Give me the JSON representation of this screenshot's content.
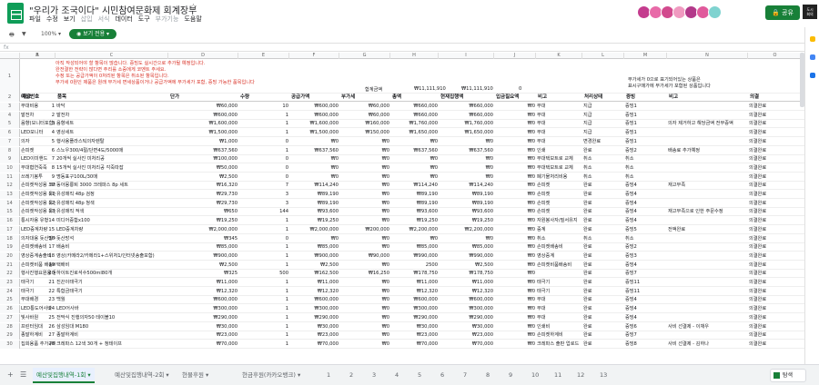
{
  "header": {
    "title": "\"우리가 조국이다\" 시민참여문화제 회계장부",
    "star_icon": "star-icon",
    "menu": [
      "파일",
      "수정",
      "보기",
      "삽입",
      "서식",
      "데이터",
      "도구",
      "부가기능",
      "도움말"
    ],
    "menu_disabled": [
      false,
      false,
      false,
      true,
      true,
      false,
      false,
      true,
      false
    ],
    "share_label": "공유",
    "account_text": "도시\n회의"
  },
  "toolbar": {
    "zoom": "100%",
    "view_only_label": "보기 전용",
    "cell_ref": "fx"
  },
  "columns": [
    "A",
    "B",
    "C",
    "D",
    "E",
    "F",
    "G",
    "H",
    "I",
    "J",
    "K",
    "L",
    "M",
    "N",
    "O"
  ],
  "instructions": {
    "lines": [
      "아직 작성되어야 할 항목이 많습니다. 증빙도 실시간으로 추가될 예정입니다.",
      "완전결한 전략이 많다면 주리를 소중에게 코멘트 주세요.",
      "수정 또는 공급가액이 0처리된 항목은 취소된 항목입니다.",
      "부가세 0원인 제품은 원래 부가세 면세상품이거나 공급가액에 부가세가 포함, 증빙 가능한 품목입니다"
    ],
    "sum_label": "합계금액",
    "sum_value1": "₩11,111,910",
    "sum_value2": "₩11,111,910",
    "sum_value3": "0",
    "right_note": "부가세가 0으로 표기되어있는 상품은\n표시구매가에 부가세가 포함된 상품입니다"
  },
  "headers": [
    "예산번호",
    "적요",
    "품목",
    "단가",
    "수량",
    "공급가액",
    "부가세",
    "총액",
    "현재집행액",
    "입금필요액",
    "비고",
    "처리상태",
    "증빙",
    "비고",
    "의결"
  ],
  "rows": [
    [
      "1",
      "무대비용",
      "바닥",
      "₩60,000",
      "10",
      "₩600,000",
      "₩60,000",
      "₩660,000",
      "₩660,000",
      "₩0",
      "무대",
      "지급",
      "증빙1",
      "",
      "의결완료"
    ],
    [
      "2",
      "발전차",
      "발전차",
      "₩600,000",
      "1",
      "₩600,000",
      "₩60,000",
      "₩660,000",
      "₩660,000",
      "₩0",
      "무대",
      "지급",
      "증빙1",
      "",
      "의결완료"
    ],
    [
      "3",
      "음향(모니터포함)",
      "음향세트",
      "₩1,600,000",
      "1",
      "₩1,600,000",
      "₩160,000",
      "₩1,760,000",
      "₩1,760,000",
      "₩0",
      "무대",
      "지급",
      "증빙1",
      "의자 제거하고 해당금액 전부증액",
      "의결완료"
    ],
    [
      "4",
      "LED모니터",
      "영상세트",
      "₩1,500,000",
      "1",
      "₩1,500,000",
      "₩150,000",
      "₩1,650,000",
      "₩1,650,000",
      "₩0",
      "무대",
      "지급",
      "증빙1",
      "",
      "의결완료"
    ],
    [
      "5",
      "의자",
      "행사용플라스틱의자렌탈",
      "₩1,000",
      "0",
      "₩0",
      "₩0",
      "₩0",
      "₩0",
      "₩0",
      "무대",
      "변경완료",
      "증빙1",
      "",
      "의결완료"
    ],
    [
      "6",
      "손피켓",
      "스노우300/4절/단면4도/5000매",
      "₩637,560",
      "1",
      "₩637,560",
      "₩0",
      "₩637,560",
      "₩637,560",
      "₩0",
      "인쇄",
      "완료",
      "증빙2",
      "배송료 추가예정",
      "의결완료"
    ],
    [
      "7",
      "LED이미핸드",
      "20개씩 실사진 미처리공",
      "₩100,000",
      "0",
      "₩0",
      "₩0",
      "₩0",
      "₩0",
      "₩0",
      "무대택보트로 교체",
      "취소",
      "취소",
      "",
      "의결완료"
    ],
    [
      "8",
      "무대협연죽죽",
      "15개씩 실사진 미처리공 각죽따잡",
      "₩50,000",
      "0",
      "₩0",
      "₩0",
      "₩0",
      "₩0",
      "₩0",
      "무대택보트로 교체",
      "취소",
      "취소",
      "",
      "의결완료"
    ],
    [
      "9",
      "쓰레기봉투",
      "명동표구100L/30매",
      "₩2,500",
      "0",
      "₩0",
      "₩0",
      "₩0",
      "₩0",
      "₩0",
      "폐기물처리비용",
      "취소",
      "취소",
      "",
      "의결완료"
    ],
    [
      "10",
      "손피켓작성용 크레파스",
      "동아몽룡퇴 3000 크레파스 8p 세트",
      "₩16,320",
      "7",
      "₩114,240",
      "₩0",
      "₩114,240",
      "₩114,240",
      "₩0",
      "손피켓",
      "완료",
      "증빙4",
      "재고부족",
      "의결완료"
    ],
    [
      "11",
      "손피켓작성용 유성매직",
      "유성매직 48p 검정",
      "₩29,730",
      "3",
      "₩89,190",
      "₩0",
      "₩89,190",
      "₩89,190",
      "₩0",
      "손피켓",
      "완료",
      "증빙4",
      "",
      "의결완료"
    ],
    [
      "12",
      "손피켓작성용 유성매직",
      "유성매직 48p 청색",
      "₩29,730",
      "3",
      "₩89,190",
      "₩0",
      "₩89,190",
      "₩89,190",
      "₩0",
      "손피켓",
      "완료",
      "증빙4",
      "",
      "의결완료"
    ],
    [
      "13",
      "손피켓작성용 유성매직",
      "유성매직 적색",
      "₩650",
      "144",
      "₩93,600",
      "₩0",
      "₩93,600",
      "₩93,600",
      "₩0",
      "손피켓",
      "완료",
      "증빙4",
      "재고부족으로 인한 주문수정",
      "의결완료"
    ],
    [
      "14",
      "통시자용 유형",
      "미디어중합x100",
      "₩19,250",
      "1",
      "₩19,250",
      "₩0",
      "₩19,250",
      "₩19,250",
      "₩0",
      "자원봉사자/질서유지",
      "완료",
      "증빙4",
      "",
      "의결완료"
    ],
    [
      "15",
      "LED중계차량",
      "LED중계차량",
      "₩2,000,000",
      "1",
      "₩2,000,000",
      "₩200,000",
      "₩2,200,000",
      "₩2,200,000",
      "₩0",
      "중계",
      "완료",
      "증빙5",
      "전액완료",
      "의결완료"
    ],
    [
      "16",
      "의자대용 돗산방석",
      "돗산방석",
      "₩345",
      "0",
      "₩0",
      "₩0",
      "₩0",
      "₩0",
      "₩0",
      "취소",
      "취소",
      "취소",
      "",
      "의결완료"
    ],
    [
      "17",
      "손피켓배송비",
      "배송비",
      "₩85,000",
      "1",
      "₩85,000",
      "₩0",
      "₩85,000",
      "₩85,000",
      "₩0",
      "손피켓배송비",
      "완료",
      "증빙2",
      "",
      "의결완료"
    ],
    [
      "18",
      "영상중계송출비",
      "영상(카메라2/카메라1+스위처1/인터넷송출포함)",
      "₩900,000",
      "1",
      "₩900,000",
      "₩90,000",
      "₩990,000",
      "₩990,000",
      "₩0",
      "영상중계",
      "완료",
      "증빙3",
      "",
      "의결완료"
    ],
    [
      "19",
      "손피켓비품 배송비",
      "택배비",
      "₩2,500",
      "1",
      "₩2,500",
      "₩0",
      "2500",
      "₩2,500",
      "₩0",
      "손피켓비품배송비",
      "완료",
      "증빙4",
      "",
      "의결완료"
    ],
    [
      "20",
      "행사진행요원용 물",
      "하이트진로석수500ml80개",
      "₩325",
      "500",
      "₩162,500",
      "₩16,250",
      "₩178,750",
      "₩178,750",
      "₩0",
      "",
      "완료",
      "증빙7",
      "",
      "의결완료"
    ],
    [
      "21",
      "태극기",
      "진끈이태극기",
      "₩11,000",
      "1",
      "₩11,000",
      "₩0",
      "₩11,000",
      "₩11,000",
      "₩0",
      "태극기",
      "완료",
      "증빙11",
      "",
      "의결완료"
    ],
    [
      "22",
      "태극기",
      "특합금태극기",
      "₩12,320",
      "1",
      "₩12,320",
      "₩0",
      "₩12,320",
      "₩12,320",
      "₩0",
      "태극기",
      "완료",
      "증빙11",
      "",
      "의결완료"
    ],
    [
      "23",
      "무대배경",
      "백월",
      "₩600,000",
      "1",
      "₩600,000",
      "₩0",
      "₩600,000",
      "₩600,000",
      "₩0",
      "무대",
      "완료",
      "증빙4",
      "",
      "의결완료"
    ],
    [
      "24",
      "LED통도어사바",
      "LED어사바",
      "₩300,000",
      "1",
      "₩300,000",
      "₩0",
      "₩300,000",
      "₩300,000",
      "₩0",
      "무대",
      "완료",
      "증빙4",
      "",
      "의결완료"
    ],
    [
      "25",
      "빛사바원",
      "전막식 진행의자50 테이블10",
      "₩290,000",
      "1",
      "₩290,000",
      "₩0",
      "₩290,000",
      "₩290,000",
      "₩0",
      "무대",
      "완료",
      "증빙4",
      "",
      "의결완료"
    ],
    [
      "26",
      "프린터임대",
      "삼성임대 M180",
      "₩30,000",
      "1",
      "₩30,000",
      "₩0",
      "₩30,000",
      "₩30,000",
      "₩0",
      "인쇄비",
      "완료",
      "증빙6",
      "사비 선결제 - 이채우",
      "의결완료"
    ],
    [
      "27",
      "종말하계비",
      "종말하계비",
      "₩23,000",
      "1",
      "₩23,000",
      "₩0",
      "₩23,000",
      "₩23,000",
      "₩0",
      "손피켓하계비",
      "완료",
      "증빙7",
      "",
      "의결완료"
    ],
    [
      "28",
      "집회용품 추가구매",
      "크레파스 12색 30개 + 청테이프",
      "₩70,000",
      "1",
      "₩70,000",
      "₩0",
      "₩70,000",
      "₩70,000",
      "₩0",
      "크레파스 출판 업로드",
      "완료",
      "증빙8",
      "사비 선결제 - 김하나",
      "의결완료"
    ]
  ],
  "sheets": {
    "tabs": [
      "예산및집행내역-1회",
      "예산및집행내역-2회",
      "현물후원",
      "현금후원(카카오뱅크)",
      "1",
      "2",
      "3",
      "4",
      "5",
      "6",
      "7",
      "8",
      "9",
      "10",
      "11",
      "12",
      "13"
    ],
    "active_index": 0,
    "explore_label": "탐색"
  },
  "colors": {
    "accent": "#188038",
    "instruction_red": "#d93025"
  }
}
